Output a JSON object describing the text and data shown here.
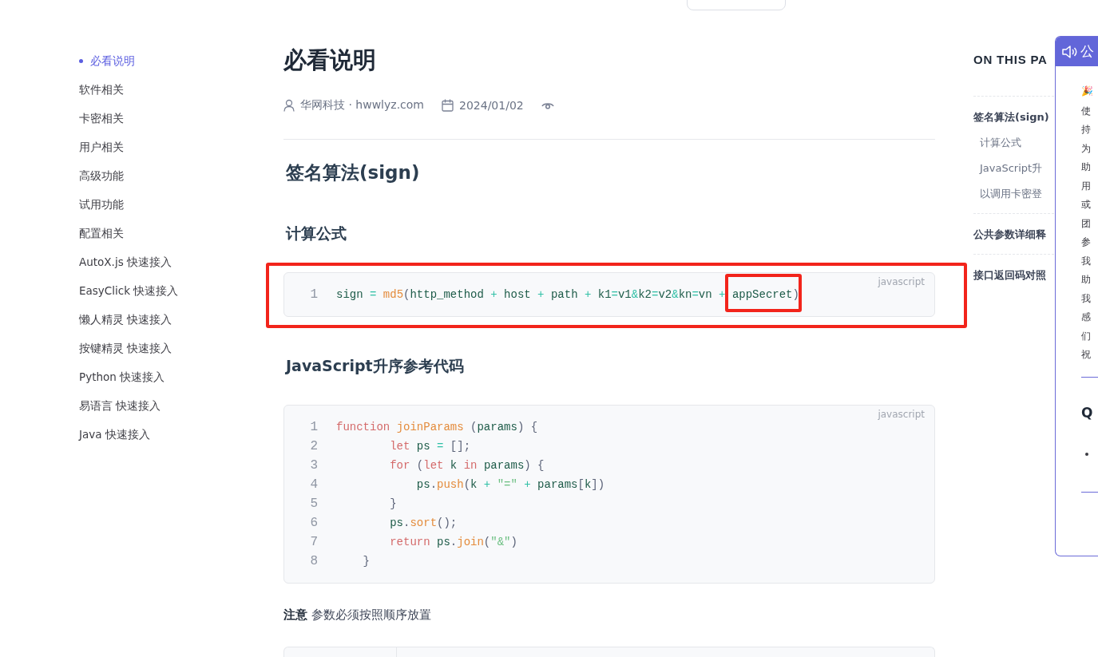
{
  "sidebar": {
    "items": [
      {
        "label": "必看说明",
        "selected": true
      },
      {
        "label": "软件相关",
        "selected": false
      },
      {
        "label": "卡密相关",
        "selected": false
      },
      {
        "label": "用户相关",
        "selected": false
      },
      {
        "label": "高级功能",
        "selected": false
      },
      {
        "label": "试用功能",
        "selected": false
      },
      {
        "label": "配置相关",
        "selected": false
      },
      {
        "label": "AutoX.js 快速接入",
        "selected": false
      },
      {
        "label": "EasyClick 快速接入",
        "selected": false
      },
      {
        "label": "懒人精灵 快速接入",
        "selected": false
      },
      {
        "label": "按键精灵 快速接入",
        "selected": false
      },
      {
        "label": "Python 快速接入",
        "selected": false
      },
      {
        "label": "易语言 快速接入",
        "selected": false
      },
      {
        "label": "Java 快速接入",
        "selected": false
      }
    ]
  },
  "article": {
    "title": "必看说明",
    "author": "华网科技 · hwwlyz.com",
    "date": "2024/01/02",
    "blocks": [
      {
        "kind": "h2",
        "text": "签名算法(sign)"
      },
      {
        "kind": "h3",
        "text": "计算公式"
      },
      {
        "kind": "code",
        "language": "javascript",
        "highlighted": true,
        "lines": [
          {
            "number": "1",
            "tokens": [
              {
                "kind": "plain",
                "text": "sign "
              },
              {
                "kind": "op",
                "text": "= "
              },
              {
                "kind": "fn",
                "text": "md5"
              },
              {
                "kind": "punc",
                "text": "("
              },
              {
                "kind": "plain",
                "text": "http_method "
              },
              {
                "kind": "op",
                "text": "+ "
              },
              {
                "kind": "plain",
                "text": "host "
              },
              {
                "kind": "op",
                "text": "+ "
              },
              {
                "kind": "plain",
                "text": "path "
              },
              {
                "kind": "op",
                "text": "+ "
              },
              {
                "kind": "plain",
                "text": "k1"
              },
              {
                "kind": "op",
                "text": "="
              },
              {
                "kind": "plain",
                "text": "v1"
              },
              {
                "kind": "op",
                "text": "&"
              },
              {
                "kind": "plain",
                "text": "k2"
              },
              {
                "kind": "op",
                "text": "="
              },
              {
                "kind": "plain",
                "text": "v2"
              },
              {
                "kind": "op",
                "text": "&"
              },
              {
                "kind": "plain",
                "text": "kn"
              },
              {
                "kind": "op",
                "text": "="
              },
              {
                "kind": "plain",
                "text": "vn "
              },
              {
                "kind": "op",
                "text": "+ "
              },
              {
                "kind": "mark",
                "text": "appSecret"
              },
              {
                "kind": "punc",
                "text": ")"
              }
            ]
          }
        ]
      },
      {
        "kind": "h3",
        "text": "JavaScript升序参考代码"
      },
      {
        "kind": "code",
        "language": "javascript",
        "lines": [
          {
            "number": "1",
            "tokens": [
              {
                "kind": "kw",
                "text": "function "
              },
              {
                "kind": "fn",
                "text": "joinParams "
              },
              {
                "kind": "punc",
                "text": "("
              },
              {
                "kind": "plain",
                "text": "params"
              },
              {
                "kind": "punc",
                "text": ") {"
              }
            ]
          },
          {
            "number": "2",
            "tokens": [
              {
                "kind": "kw",
                "text": "        let"
              },
              {
                "kind": "plain",
                "text": " ps "
              },
              {
                "kind": "op",
                "text": "= "
              },
              {
                "kind": "punc",
                "text": "[];"
              }
            ]
          },
          {
            "number": "3",
            "tokens": [
              {
                "kind": "kw",
                "text": "        for"
              },
              {
                "kind": "punc",
                "text": " ("
              },
              {
                "kind": "kw",
                "text": "let"
              },
              {
                "kind": "plain",
                "text": " k "
              },
              {
                "kind": "kw",
                "text": "in"
              },
              {
                "kind": "plain",
                "text": " params"
              },
              {
                "kind": "punc",
                "text": ") {"
              }
            ]
          },
          {
            "number": "4",
            "tokens": [
              {
                "kind": "plain",
                "text": "            ps"
              },
              {
                "kind": "punc",
                "text": "."
              },
              {
                "kind": "fn",
                "text": "push"
              },
              {
                "kind": "punc",
                "text": "("
              },
              {
                "kind": "plain",
                "text": "k "
              },
              {
                "kind": "op",
                "text": "+ "
              },
              {
                "kind": "str",
                "text": "\"=\""
              },
              {
                "kind": "op",
                "text": " + "
              },
              {
                "kind": "plain",
                "text": "params"
              },
              {
                "kind": "punc",
                "text": "["
              },
              {
                "kind": "plain",
                "text": "k"
              },
              {
                "kind": "punc",
                "text": "])"
              }
            ]
          },
          {
            "number": "5",
            "tokens": [
              {
                "kind": "punc",
                "text": "        }"
              }
            ]
          },
          {
            "number": "6",
            "tokens": [
              {
                "kind": "plain",
                "text": "        ps"
              },
              {
                "kind": "punc",
                "text": "."
              },
              {
                "kind": "fn",
                "text": "sort"
              },
              {
                "kind": "punc",
                "text": "();"
              }
            ]
          },
          {
            "number": "7",
            "tokens": [
              {
                "kind": "kw",
                "text": "        return"
              },
              {
                "kind": "plain",
                "text": " ps"
              },
              {
                "kind": "punc",
                "text": "."
              },
              {
                "kind": "fn",
                "text": "join"
              },
              {
                "kind": "punc",
                "text": "("
              },
              {
                "kind": "str",
                "text": "\"&\""
              },
              {
                "kind": "punc",
                "text": ")"
              }
            ]
          },
          {
            "number": "8",
            "tokens": [
              {
                "kind": "punc",
                "text": "    }"
              }
            ]
          }
        ]
      },
      {
        "kind": "note",
        "text": "**注意** 参数必须按照顺序放置"
      },
      {
        "kind": "table"
      }
    ]
  },
  "toc": {
    "title": "ON THIS PA",
    "items": [
      {
        "label": "签名算法(sign)",
        "children": [
          {
            "label": "计算公式"
          },
          {
            "label": "JavaScript升"
          },
          {
            "label": "以调用卡密登"
          }
        ]
      },
      {
        "label": "公共参数详细释"
      },
      {
        "label": "接口返回码对照"
      }
    ]
  },
  "notice": {
    "title": "公",
    "lines": [
      "🎉",
      "使",
      "持",
      "为",
      "助",
      "用",
      "或",
      "团",
      "参",
      "我",
      "助",
      "我",
      "感",
      "们",
      "祝"
    ],
    "heading": "Q"
  }
}
